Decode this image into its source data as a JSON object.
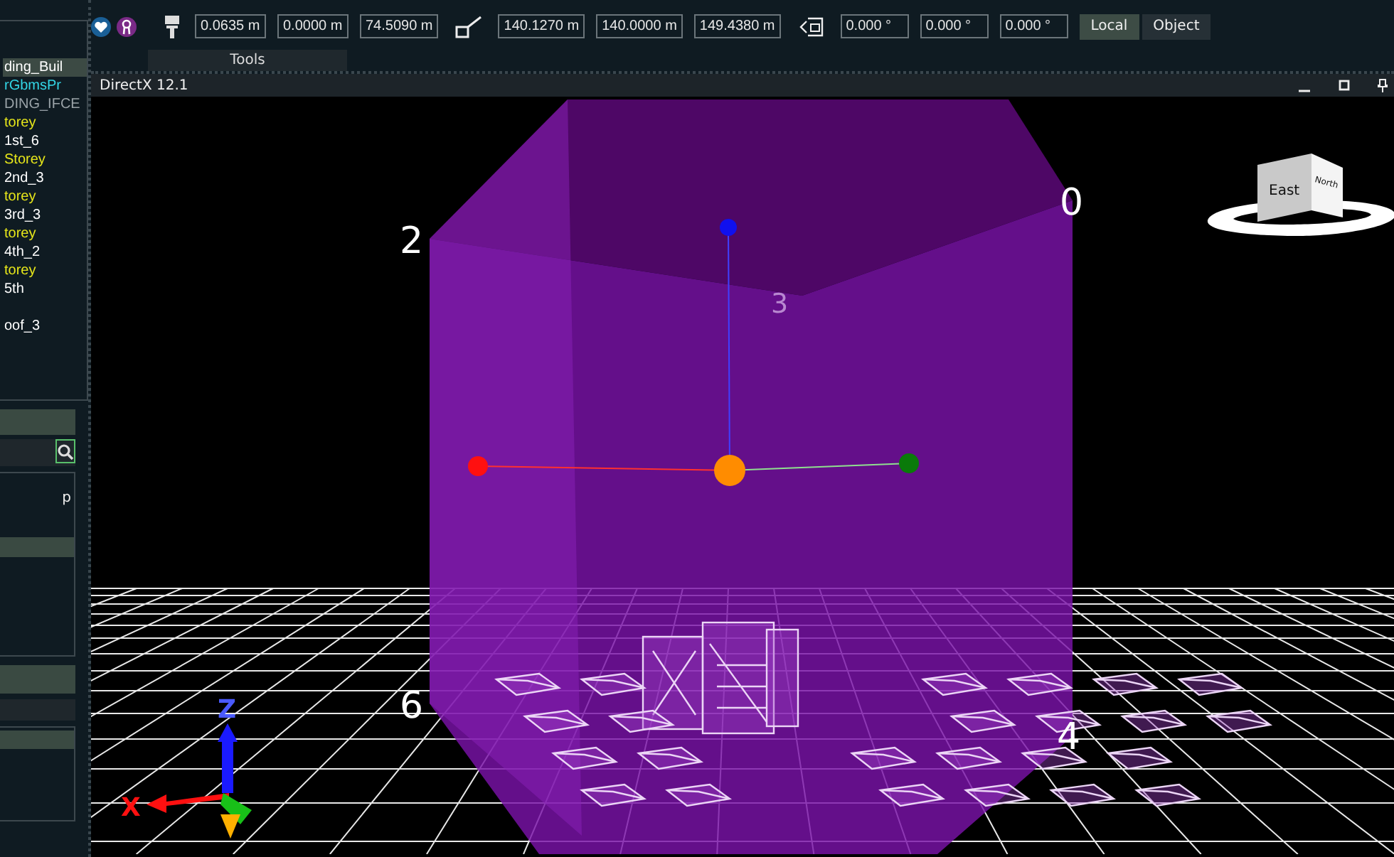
{
  "sidebar": {
    "tree_items": [
      {
        "label": "ding_Buil",
        "color": "#ffffff",
        "selected": true
      },
      {
        "label": "rGbmsPr",
        "color": "#33d6e6",
        "selected": false
      },
      {
        "label": "DING_IFCE",
        "color": "#9aa3a8",
        "selected": false
      },
      {
        "label": "torey",
        "color": "#e6e61a",
        "selected": false
      },
      {
        "label": "1st_6",
        "color": "#ffffff",
        "selected": false
      },
      {
        "label": "Storey",
        "color": "#e6e61a",
        "selected": false
      },
      {
        "label": "2nd_3",
        "color": "#ffffff",
        "selected": false
      },
      {
        "label": "torey",
        "color": "#e6e61a",
        "selected": false
      },
      {
        "label": "3rd_3",
        "color": "#ffffff",
        "selected": false
      },
      {
        "label": "torey",
        "color": "#e6e61a",
        "selected": false
      },
      {
        "label": "4th_2",
        "color": "#ffffff",
        "selected": false
      },
      {
        "label": "torey",
        "color": "#e6e61a",
        "selected": false
      },
      {
        "label": "5th",
        "color": "#ffffff",
        "selected": false
      },
      {
        "label": "oof_3",
        "color": "#ffffff",
        "selected": false
      }
    ],
    "panel_text": "p"
  },
  "toolbar": {
    "position": [
      "0.0635 m",
      "0.0000 m",
      "74.5090 m"
    ],
    "size": [
      "140.1270 m",
      "140.0000 m",
      "149.4380 m"
    ],
    "rotation": [
      "0.000 °",
      "0.000 °",
      "0.000 °"
    ],
    "space_buttons": [
      {
        "label": "Local",
        "selected": true
      },
      {
        "label": "Object",
        "selected": false
      }
    ],
    "group_label": "Tools"
  },
  "viewport": {
    "title": "DirectX 12.1",
    "corner_labels": [
      {
        "text": "2",
        "kind": "bright"
      },
      {
        "text": "0",
        "kind": "bright"
      },
      {
        "text": "3",
        "kind": "faint"
      },
      {
        "text": "6",
        "kind": "bright"
      },
      {
        "text": "4",
        "kind": "bright"
      }
    ],
    "axis_labels": {
      "x": "X",
      "z": "Z"
    },
    "view_cube": {
      "front": "East",
      "side": "North"
    }
  }
}
